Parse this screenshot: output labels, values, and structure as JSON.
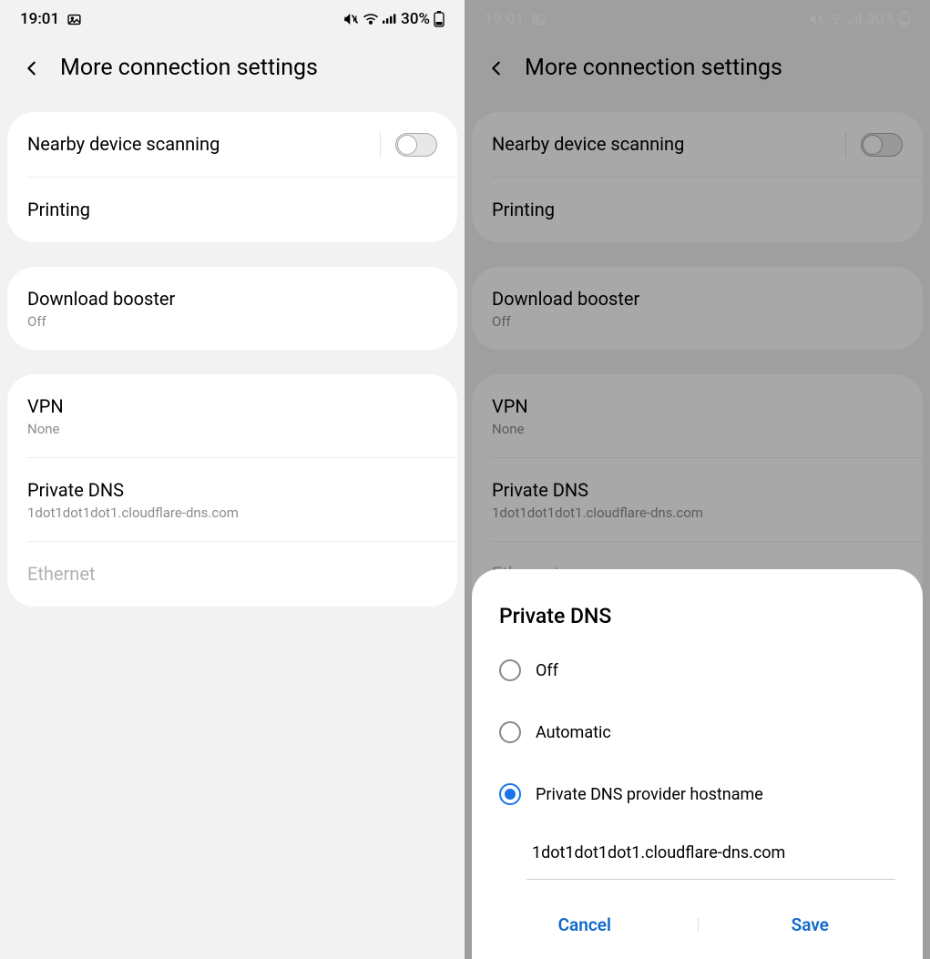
{
  "status": {
    "time": "19:01",
    "battery_pct": "30%"
  },
  "header": {
    "title": "More connection settings"
  },
  "rows": {
    "nearby": {
      "title": "Nearby device scanning"
    },
    "printing": {
      "title": "Printing"
    },
    "download_booster": {
      "title": "Download booster",
      "sub": "Off"
    },
    "vpn": {
      "title": "VPN",
      "sub": "None"
    },
    "private_dns": {
      "title": "Private DNS",
      "sub": "1dot1dot1dot1.cloudflare-dns.com"
    },
    "ethernet": {
      "title": "Ethernet"
    }
  },
  "dialog": {
    "title": "Private DNS",
    "options": {
      "off": "Off",
      "auto": "Automatic",
      "hostname": "Private DNS provider hostname"
    },
    "selected": "hostname",
    "hostname_value": "1dot1dot1dot1.cloudflare-dns.com",
    "cancel": "Cancel",
    "save": "Save"
  }
}
